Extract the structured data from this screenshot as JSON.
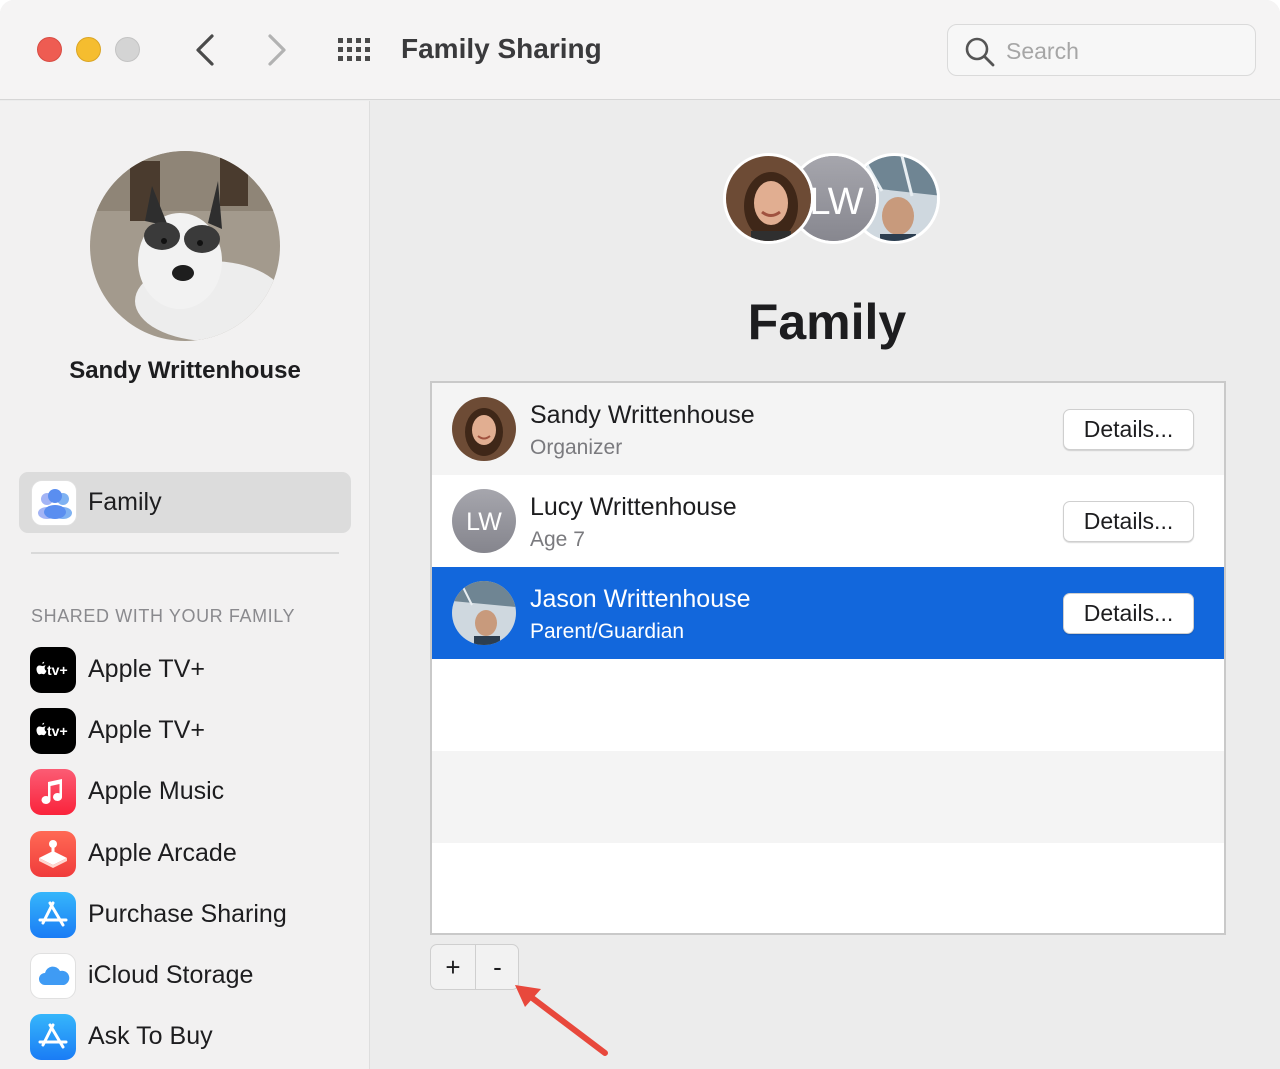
{
  "window": {
    "title": "Family Sharing",
    "search_placeholder": "Search"
  },
  "sidebar": {
    "user_name": "Sandy Writtenhouse",
    "selected_item": {
      "label": "Family",
      "icon": "family-icon"
    },
    "section_header": "SHARED WITH YOUR FAMILY",
    "items": [
      {
        "label": "Apple TV+",
        "icon": "apple-tv-icon",
        "icon_text": "tv+"
      },
      {
        "label": "Apple TV+",
        "icon": "apple-tv-icon",
        "icon_text": "tv+"
      },
      {
        "label": "Apple Music",
        "icon": "apple-music-icon"
      },
      {
        "label": "Apple Arcade",
        "icon": "apple-arcade-icon"
      },
      {
        "label": "Purchase Sharing",
        "icon": "app-store-icon"
      },
      {
        "label": "iCloud Storage",
        "icon": "icloud-icon"
      },
      {
        "label": "Ask To Buy",
        "icon": "app-store-icon"
      }
    ]
  },
  "main": {
    "heading": "Family",
    "avatar_initials": "LW",
    "members": [
      {
        "name": "Sandy Writtenhouse",
        "role": "Organizer",
        "details": "Details..."
      },
      {
        "name": "Lucy Writtenhouse",
        "role": "Age 7",
        "initials": "LW",
        "details": "Details..."
      },
      {
        "name": "Jason Writtenhouse",
        "role": "Parent/Guardian",
        "details": "Details...",
        "selected": true
      }
    ],
    "add_label": "+",
    "remove_label": "-"
  },
  "colors": {
    "selection": "#1267dc",
    "close": "#ee5c52",
    "minimize": "#f5bd2f",
    "annotation_arrow": "#e8483c"
  }
}
